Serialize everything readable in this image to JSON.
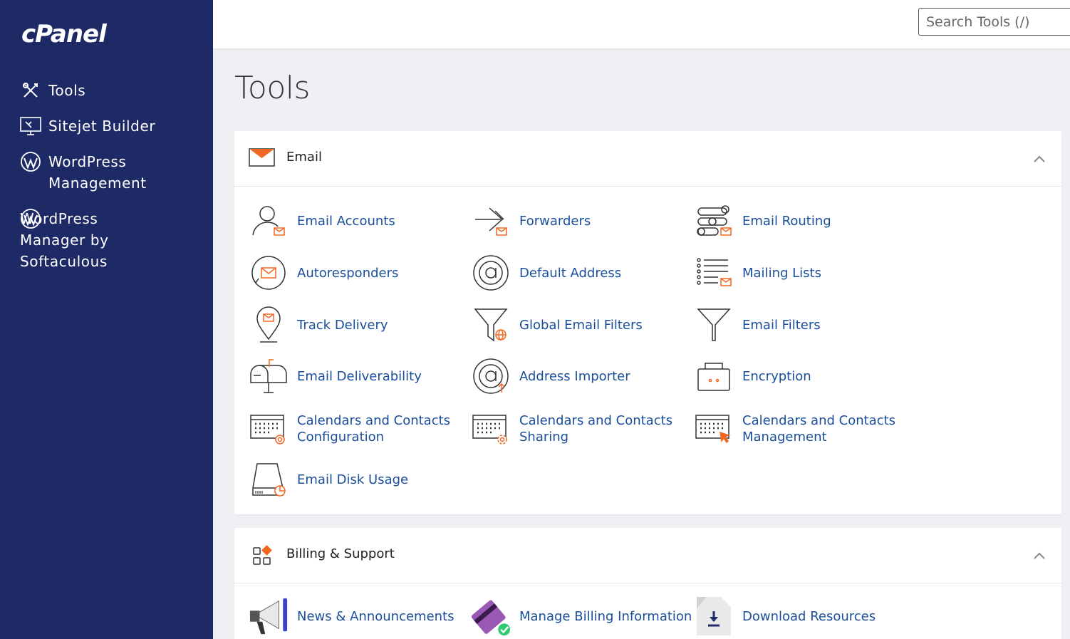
{
  "sidebar": {
    "logo": "cPanel",
    "items": [
      {
        "label": "Tools",
        "icon": "tools-icon"
      },
      {
        "label": "Sitejet Builder",
        "icon": "sitejet-icon"
      },
      {
        "label": "WordPress\nManagement",
        "icon": "wordpress-icon"
      },
      {
        "label": "WordPress\n  Manager by\nSoftaculous",
        "icon": "wordpress-icon"
      }
    ]
  },
  "header": {
    "search_placeholder": "Search Tools (/)"
  },
  "page": {
    "title": "Tools"
  },
  "sections": {
    "email": {
      "title": "Email",
      "items": [
        "Email Accounts",
        "Forwarders",
        "Email Routing",
        "Autoresponders",
        "Default Address",
        "Mailing Lists",
        "Track Delivery",
        "Global Email Filters",
        "Email Filters",
        "Email Deliverability",
        "Address Importer",
        "Encryption",
        "Calendars and Contacts\nConfiguration",
        "Calendars and Contacts\nSharing",
        "Calendars and Contacts\nManagement",
        "Email Disk Usage"
      ]
    },
    "billing": {
      "title": "Billing & Support",
      "items": [
        "News & Announcements",
        "Manage Billing Information",
        "Download Resources"
      ]
    }
  },
  "colors": {
    "sidebar_bg": "#1e2a66",
    "link": "#1a4e9b",
    "accent": "#f26822"
  }
}
